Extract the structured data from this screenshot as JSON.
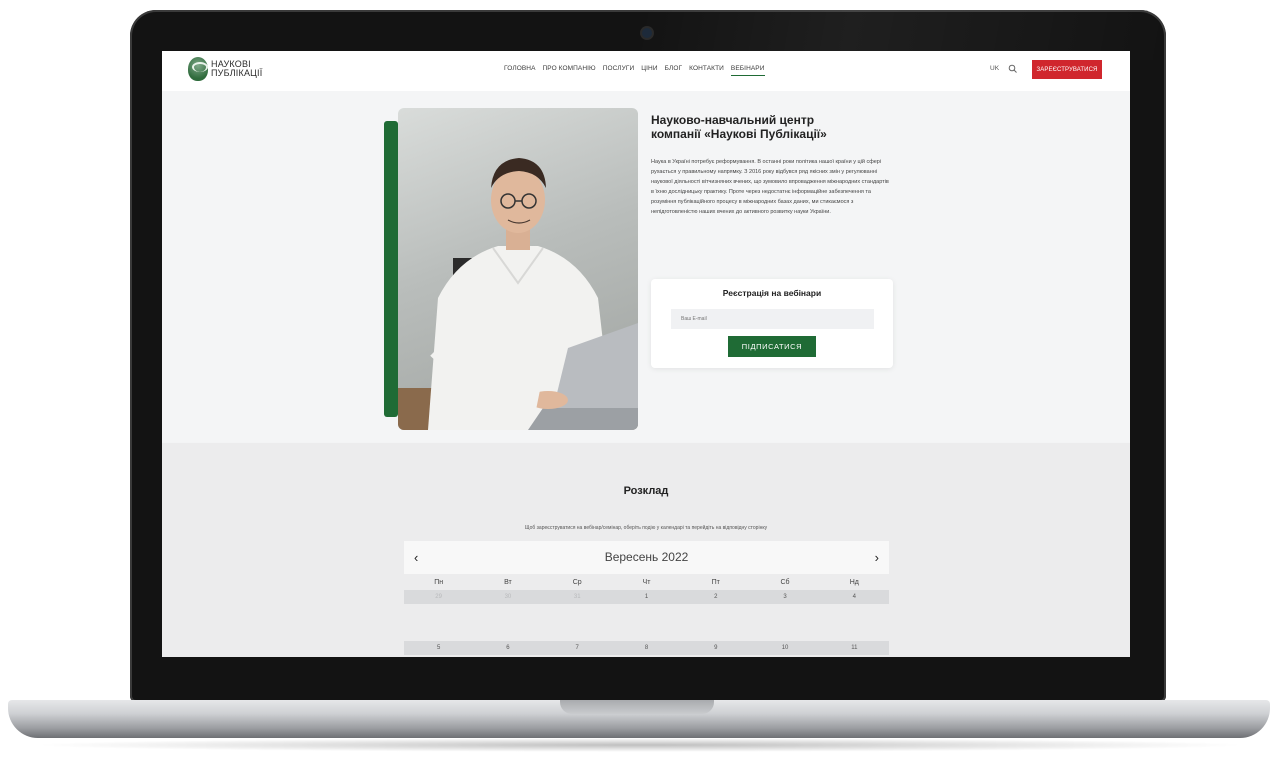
{
  "header": {
    "logo_line1": "НАУКОВІ",
    "logo_line2": "ПУБЛІКАЦІЇ",
    "nav": [
      {
        "label": "ГОЛОВНА",
        "active": false
      },
      {
        "label": "ПРО КОМПАНІЮ",
        "active": false
      },
      {
        "label": "ПОСЛУГИ",
        "active": false
      },
      {
        "label": "ЦІНИ",
        "active": false
      },
      {
        "label": "БЛОГ",
        "active": false
      },
      {
        "label": "КОНТАКТИ",
        "active": false
      },
      {
        "label": "ВЕБІНАРИ",
        "active": true
      }
    ],
    "lang": "UK",
    "register_label": "ЗАРЕЄСТРУВАТИСЯ"
  },
  "hero": {
    "title": "Науково-навчальний центр компанії «Наукові Публікації»",
    "text": "Наука в Україні потребує реформування. В останні роки політика нашої країни у цій сфері рухається у правильному напрямку. З 2016 року відбувся ряд якісних змін у регулюванні наукової діяльності вітчизняних вчених, що зумовило впровадження міжнародних стандартів в їхню дослідницьку практику. Проте через недостатнє інформаційне забезпечення та розуміння публікаційного процесу в міжнародних базах даних, ми стикаємося з непідготовленістю наших вчених до активного розвитку науки України.",
    "registration": {
      "title": "Реєстрація на вебінари",
      "email_placeholder": "Ваш E-mail",
      "button": "ПІДПИСАТИСЯ"
    }
  },
  "schedule": {
    "title": "Розклад",
    "subtitle": "Щоб зареєструватися на вебінар/семінар, оберіть подію у календарі та перейдіть на відповідну сторінку",
    "calendar": {
      "month": "Вересень 2022",
      "prev": "‹",
      "next": "›",
      "weekdays": [
        "Пн",
        "Вт",
        "Ср",
        "Чт",
        "Пт",
        "Сб",
        "Нд"
      ],
      "weeks": [
        [
          "29",
          "30",
          "31",
          "1",
          "2",
          "3",
          "4"
        ],
        [
          "5",
          "6",
          "7",
          "8",
          "9",
          "10",
          "11"
        ]
      ]
    }
  },
  "colors": {
    "brand_green": "#1f6b35",
    "cta_red": "#d0262d"
  }
}
